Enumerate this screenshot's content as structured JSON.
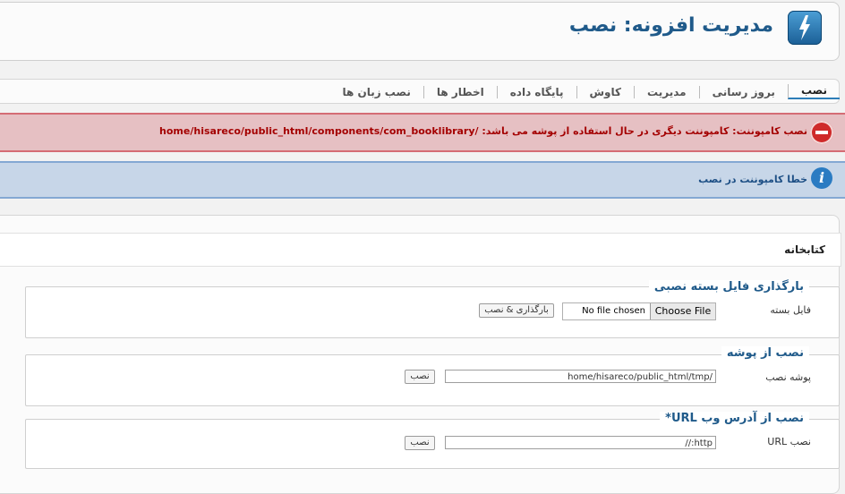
{
  "header": {
    "title": "مدیریت افزونه: نصب",
    "logo_icon": "bolt-icon"
  },
  "tabs": [
    {
      "label": "نصب",
      "active": true
    },
    {
      "label": "بروز رسانی"
    },
    {
      "label": "مدیریت"
    },
    {
      "label": "کاوش"
    },
    {
      "label": "پایگاه داده"
    },
    {
      "label": "اخطار ها"
    },
    {
      "label": "نصب زبان ها"
    }
  ],
  "alerts": {
    "error": {
      "icon": "error-minus-icon",
      "text": "نصب کامپوننت: کامپوننت دیگری در حال استفاده از پوشه می باشد: /home/hisareco/public_html/components/com_booklibrary",
      "color": "#a40000"
    },
    "info": {
      "icon": "info-icon",
      "icon_glyph": "i",
      "text": "خطا کامپوننت در نصب",
      "color": "#1d4f85"
    }
  },
  "section": {
    "title": "کتابخانه"
  },
  "upload": {
    "legend": "بارگذاری فایل بسته نصبی",
    "label": "فایل بسته",
    "choose_button": "Choose File",
    "no_file_text": "No file chosen",
    "submit_label": "بارگذاری & نصب"
  },
  "folder_install": {
    "legend": "نصب از پوشه",
    "label": "پوشه نصب",
    "value": "/home/hisareco/public_html/tmp",
    "submit_label": "نصب"
  },
  "url_install": {
    "legend": "نصب از آدرس وب URL*",
    "label": "نصب URL",
    "value": "http://",
    "submit_label": "نصب"
  }
}
